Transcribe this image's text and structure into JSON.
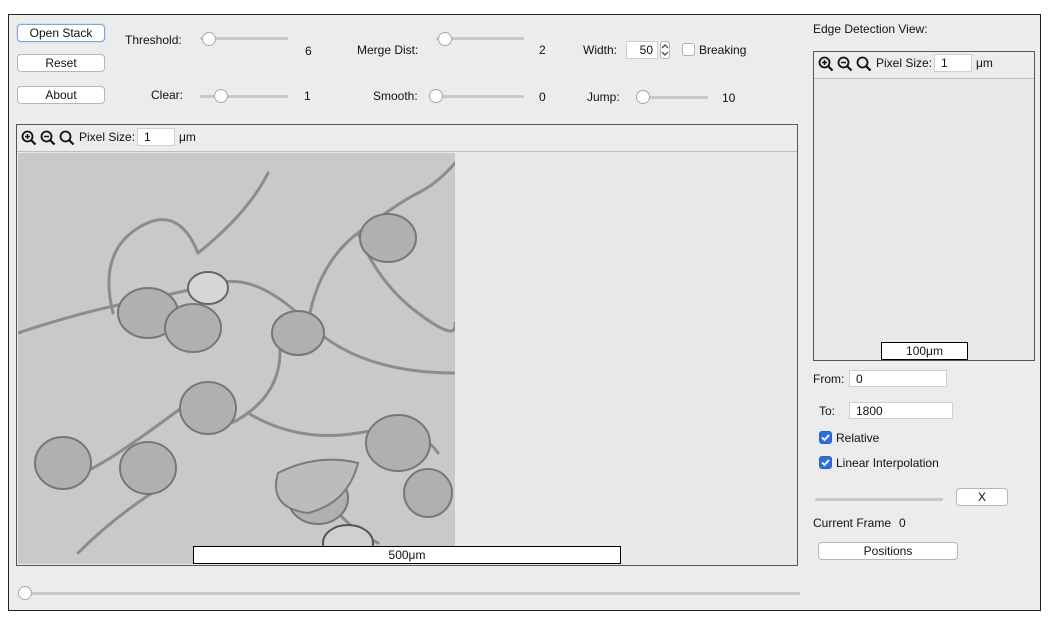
{
  "buttons": {
    "open_stack": "Open Stack",
    "reset": "Reset",
    "about": "About",
    "close_x": "X",
    "positions": "Positions"
  },
  "params": {
    "threshold": {
      "label": "Threshold:",
      "value": "6"
    },
    "merge_dist": {
      "label": "Merge Dist:",
      "value": "2"
    },
    "width": {
      "label": "Width:",
      "value": "50"
    },
    "breaking": {
      "label": "Breaking",
      "checked": false
    },
    "clear": {
      "label": "Clear:",
      "value": "1"
    },
    "smooth": {
      "label": "Smooth:",
      "value": "0"
    },
    "jump": {
      "label": "Jump:",
      "value": "10"
    }
  },
  "main_view": {
    "pixel_size_label": "Pixel Size:",
    "pixel_size_value": "1",
    "unit": "μm",
    "scale_bar": "500μm"
  },
  "edge_view": {
    "title": "Edge Detection View:",
    "pixel_size_label": "Pixel Size:",
    "pixel_size_value": "1",
    "unit": "μm",
    "scale_bar": "100μm"
  },
  "range": {
    "from_label": "From:",
    "from_value": "0",
    "to_label": "To:",
    "to_value": "1800"
  },
  "options": {
    "relative": {
      "label": "Relative",
      "checked": true
    },
    "linear_interpolation": {
      "label": "Linear Interpolation",
      "checked": true
    }
  },
  "current_frame": {
    "label": "Current Frame",
    "value": "0"
  },
  "icons": {
    "zoom_in": "zoom-in-icon",
    "zoom_out": "zoom-out-icon",
    "zoom_fit": "zoom-fit-icon"
  },
  "colors": {
    "accent": "#2f6fdc",
    "window_bg": "#ececec"
  }
}
